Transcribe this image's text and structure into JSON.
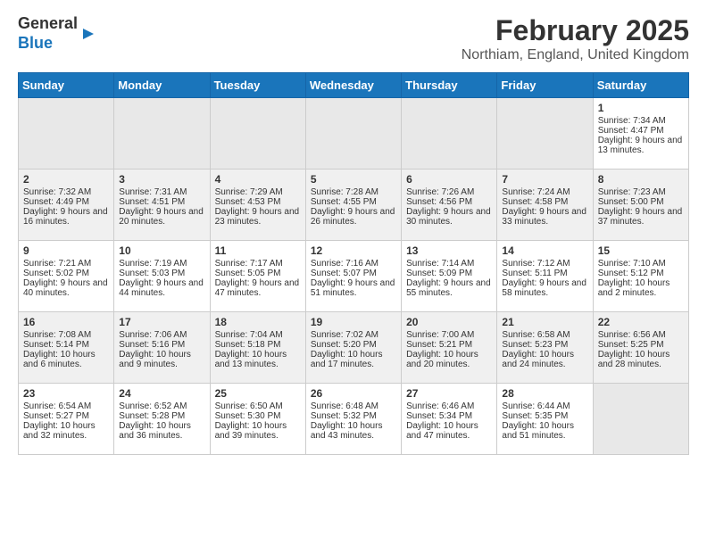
{
  "logo": {
    "line1": "General",
    "line2": "Blue"
  },
  "title": "February 2025",
  "subtitle": "Northiam, England, United Kingdom",
  "days_of_week": [
    "Sunday",
    "Monday",
    "Tuesday",
    "Wednesday",
    "Thursday",
    "Friday",
    "Saturday"
  ],
  "weeks": [
    [
      {
        "empty": true
      },
      {
        "empty": true
      },
      {
        "empty": true
      },
      {
        "empty": true
      },
      {
        "empty": true
      },
      {
        "empty": true
      },
      {
        "day": 1,
        "sunrise": "7:34 AM",
        "sunset": "4:47 PM",
        "daylight": "9 hours and 13 minutes."
      }
    ],
    [
      {
        "day": 2,
        "sunrise": "7:32 AM",
        "sunset": "4:49 PM",
        "daylight": "9 hours and 16 minutes."
      },
      {
        "day": 3,
        "sunrise": "7:31 AM",
        "sunset": "4:51 PM",
        "daylight": "9 hours and 20 minutes."
      },
      {
        "day": 4,
        "sunrise": "7:29 AM",
        "sunset": "4:53 PM",
        "daylight": "9 hours and 23 minutes."
      },
      {
        "day": 5,
        "sunrise": "7:28 AM",
        "sunset": "4:55 PM",
        "daylight": "9 hours and 26 minutes."
      },
      {
        "day": 6,
        "sunrise": "7:26 AM",
        "sunset": "4:56 PM",
        "daylight": "9 hours and 30 minutes."
      },
      {
        "day": 7,
        "sunrise": "7:24 AM",
        "sunset": "4:58 PM",
        "daylight": "9 hours and 33 minutes."
      },
      {
        "day": 8,
        "sunrise": "7:23 AM",
        "sunset": "5:00 PM",
        "daylight": "9 hours and 37 minutes."
      }
    ],
    [
      {
        "day": 9,
        "sunrise": "7:21 AM",
        "sunset": "5:02 PM",
        "daylight": "9 hours and 40 minutes."
      },
      {
        "day": 10,
        "sunrise": "7:19 AM",
        "sunset": "5:03 PM",
        "daylight": "9 hours and 44 minutes."
      },
      {
        "day": 11,
        "sunrise": "7:17 AM",
        "sunset": "5:05 PM",
        "daylight": "9 hours and 47 minutes."
      },
      {
        "day": 12,
        "sunrise": "7:16 AM",
        "sunset": "5:07 PM",
        "daylight": "9 hours and 51 minutes."
      },
      {
        "day": 13,
        "sunrise": "7:14 AM",
        "sunset": "5:09 PM",
        "daylight": "9 hours and 55 minutes."
      },
      {
        "day": 14,
        "sunrise": "7:12 AM",
        "sunset": "5:11 PM",
        "daylight": "9 hours and 58 minutes."
      },
      {
        "day": 15,
        "sunrise": "7:10 AM",
        "sunset": "5:12 PM",
        "daylight": "10 hours and 2 minutes."
      }
    ],
    [
      {
        "day": 16,
        "sunrise": "7:08 AM",
        "sunset": "5:14 PM",
        "daylight": "10 hours and 6 minutes."
      },
      {
        "day": 17,
        "sunrise": "7:06 AM",
        "sunset": "5:16 PM",
        "daylight": "10 hours and 9 minutes."
      },
      {
        "day": 18,
        "sunrise": "7:04 AM",
        "sunset": "5:18 PM",
        "daylight": "10 hours and 13 minutes."
      },
      {
        "day": 19,
        "sunrise": "7:02 AM",
        "sunset": "5:20 PM",
        "daylight": "10 hours and 17 minutes."
      },
      {
        "day": 20,
        "sunrise": "7:00 AM",
        "sunset": "5:21 PM",
        "daylight": "10 hours and 20 minutes."
      },
      {
        "day": 21,
        "sunrise": "6:58 AM",
        "sunset": "5:23 PM",
        "daylight": "10 hours and 24 minutes."
      },
      {
        "day": 22,
        "sunrise": "6:56 AM",
        "sunset": "5:25 PM",
        "daylight": "10 hours and 28 minutes."
      }
    ],
    [
      {
        "day": 23,
        "sunrise": "6:54 AM",
        "sunset": "5:27 PM",
        "daylight": "10 hours and 32 minutes."
      },
      {
        "day": 24,
        "sunrise": "6:52 AM",
        "sunset": "5:28 PM",
        "daylight": "10 hours and 36 minutes."
      },
      {
        "day": 25,
        "sunrise": "6:50 AM",
        "sunset": "5:30 PM",
        "daylight": "10 hours and 39 minutes."
      },
      {
        "day": 26,
        "sunrise": "6:48 AM",
        "sunset": "5:32 PM",
        "daylight": "10 hours and 43 minutes."
      },
      {
        "day": 27,
        "sunrise": "6:46 AM",
        "sunset": "5:34 PM",
        "daylight": "10 hours and 47 minutes."
      },
      {
        "day": 28,
        "sunrise": "6:44 AM",
        "sunset": "5:35 PM",
        "daylight": "10 hours and 51 minutes."
      },
      {
        "empty": true
      }
    ]
  ]
}
